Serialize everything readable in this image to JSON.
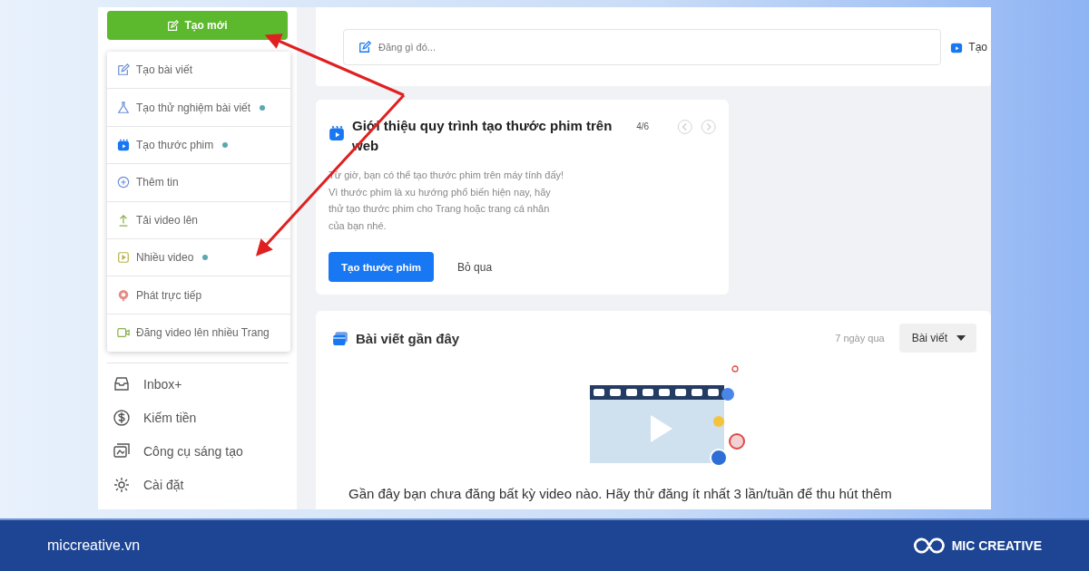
{
  "create_button": {
    "label": "Tạo mới"
  },
  "create_menu": {
    "items": [
      {
        "label": "Tạo bài viết",
        "new": false
      },
      {
        "label": "Tạo thử nghiệm bài viết",
        "new": true
      },
      {
        "label": "Tạo thước phim",
        "new": true
      },
      {
        "label": "Thêm tin",
        "new": false
      },
      {
        "label": "Tải video lên",
        "new": false
      },
      {
        "label": "Nhiều video",
        "new": true
      },
      {
        "label": "Phát trực tiếp",
        "new": false
      },
      {
        "label": "Đăng video lên nhiều Trang",
        "new": false
      }
    ]
  },
  "sidebar": {
    "items": [
      {
        "label": "Inbox+"
      },
      {
        "label": "Kiếm tiền"
      },
      {
        "label": "Công cụ sáng tạo"
      },
      {
        "label": "Cài đặt"
      }
    ]
  },
  "composer": {
    "placeholder": "Đăng gì đó...",
    "reels_button": "Tạo"
  },
  "intro_card": {
    "title": "Giới thiệu quy trình tạo thước phim trên web",
    "pager": "4/6",
    "body": "Từ giờ, bạn có thể tạo thước phim trên máy tính đấy! Vì thước phim là xu hướng phổ biến hiện nay, hãy thử tạo thước phim cho Trang hoặc trang cá nhân của bạn nhé.",
    "primary_button": "Tạo thước phim",
    "skip_button": "Bỏ qua"
  },
  "recent_posts": {
    "title": "Bài viết gần đây",
    "range": "7 ngày qua",
    "filter": "Bài viết",
    "empty_message": "Gần đây bạn chưa đăng bất kỳ video nào. Hãy thử đăng ít nhất 3 lần/tuần để thu hút thêm"
  },
  "footer": {
    "site": "miccreative.vn",
    "brand": "MIC CREATIVE"
  }
}
